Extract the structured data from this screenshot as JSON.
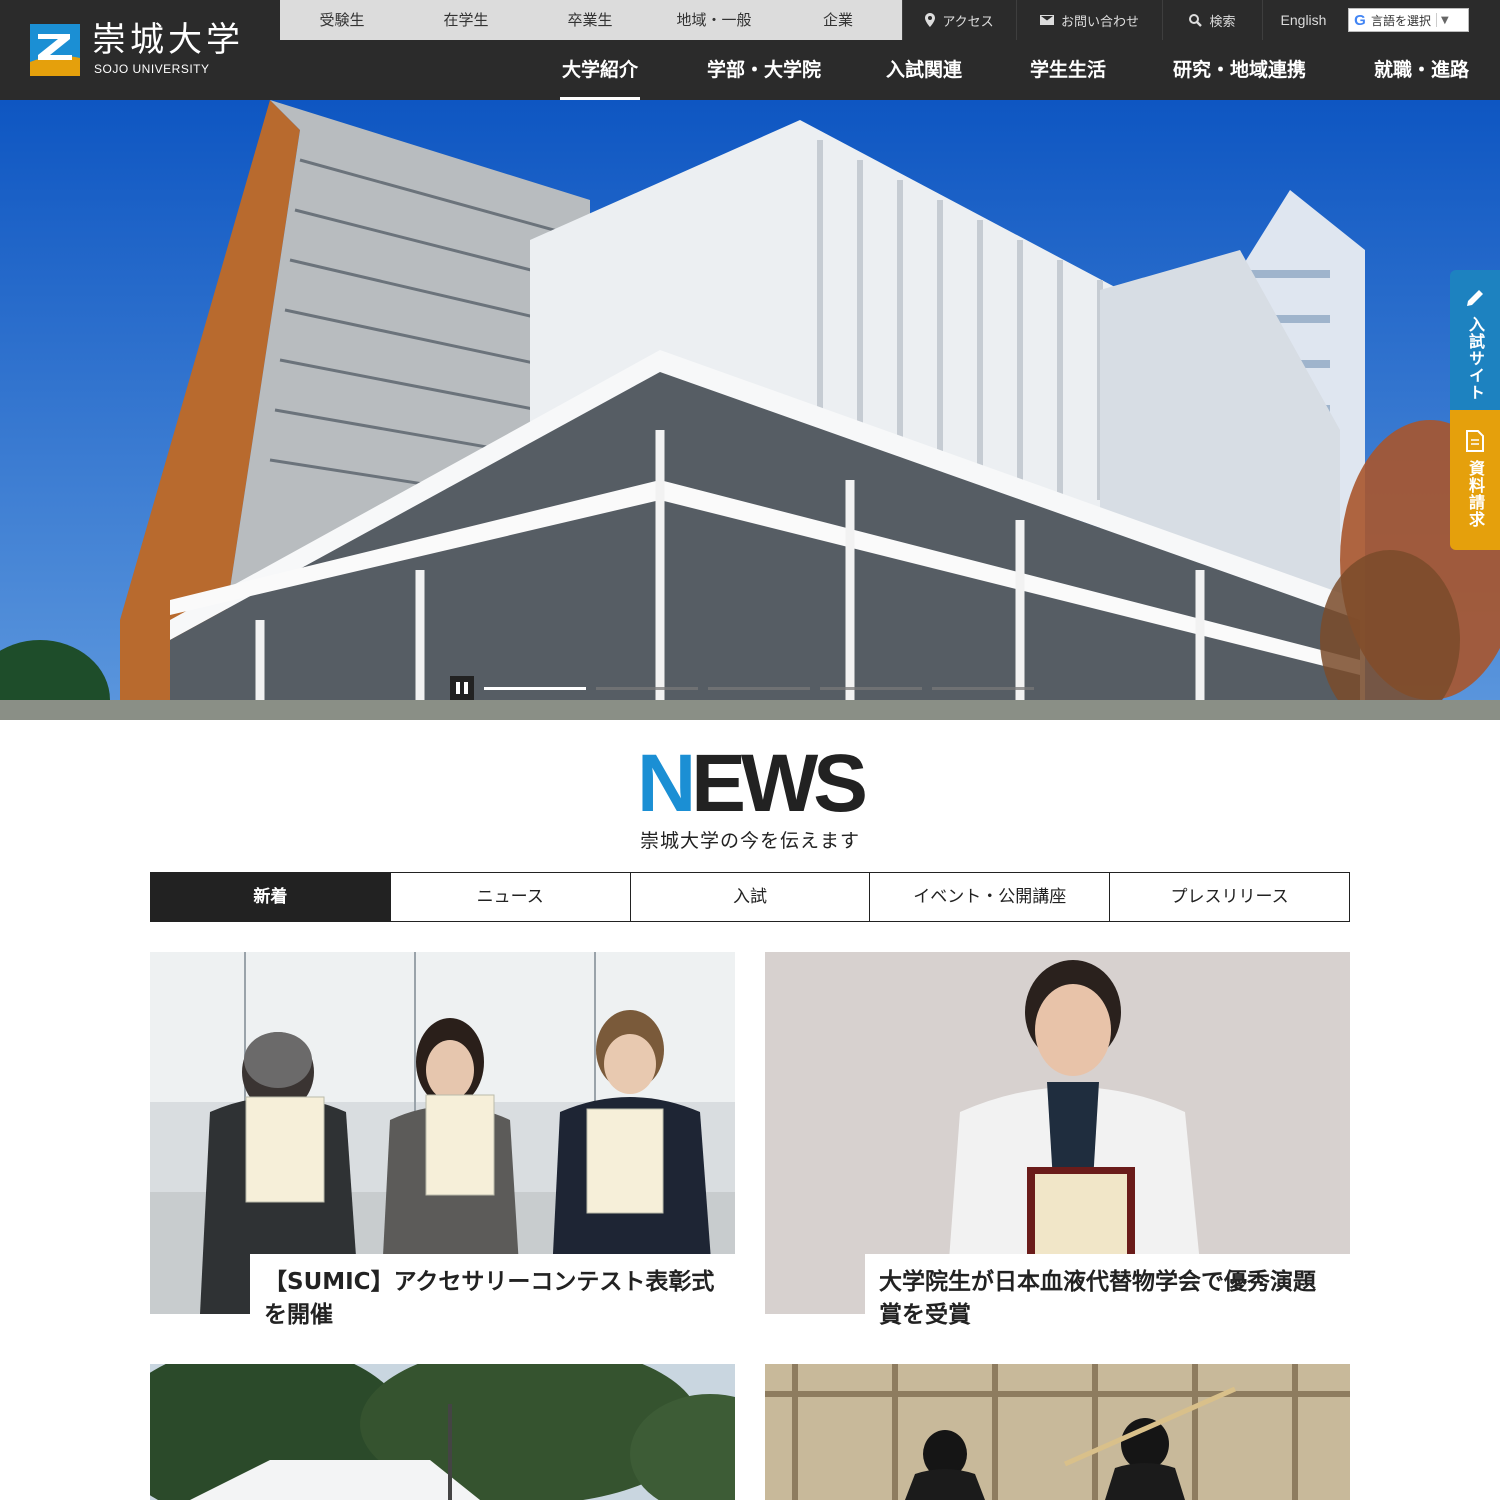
{
  "header": {
    "logo_jp": "崇城大学",
    "logo_en": "SOJO UNIVERSITY",
    "audience_links": [
      "受験生",
      "在学生",
      "卒業生",
      "地域・一般",
      "企業"
    ],
    "utility": {
      "access": "アクセス",
      "contact": "お問い合わせ",
      "search": "検索",
      "english": "English",
      "language_select": "言語を選択"
    },
    "nav": [
      "大学紹介",
      "学部・大学院",
      "入試関連",
      "学生生活",
      "研究・地域連携",
      "就職・進路"
    ]
  },
  "hero": {
    "slide_count": 5,
    "active_slide": 1
  },
  "side_tabs": {
    "exam_site": "入試サイト",
    "request": "資料請求"
  },
  "news": {
    "title_first": "N",
    "title_rest": "EWS",
    "subtitle": "崇城大学の今を伝えます",
    "tabs": [
      "新着",
      "ニュース",
      "入試",
      "イベント・公開講座",
      "プレスリリース"
    ],
    "items": [
      {
        "title": "【SUMIC】アクセサリーコンテスト表彰式を開催"
      },
      {
        "title": "大学院生が日本血液代替物学会で優秀演題賞を受賞"
      }
    ]
  },
  "colors": {
    "header_bg": "#2b2b2b",
    "accent_blue": "#1b8fd4",
    "accent_orange": "#e5a00c",
    "exam_tab": "#1d82c0"
  },
  "icons": [
    "logo-mark-icon",
    "pin-icon",
    "mail-icon",
    "search-icon",
    "google-g-icon",
    "pencil-icon",
    "document-icon",
    "pause-icon"
  ]
}
